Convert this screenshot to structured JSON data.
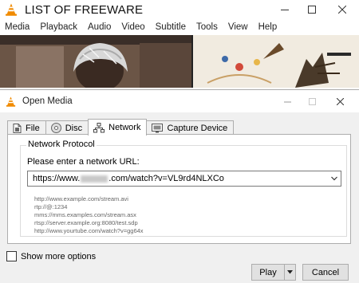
{
  "main_window": {
    "title": "LIST OF FREEWARE",
    "menu": [
      "Media",
      "Playback",
      "Audio",
      "Video",
      "Subtitle",
      "Tools",
      "View",
      "Help"
    ]
  },
  "dialog": {
    "title": "Open Media",
    "tabs": [
      {
        "label": "File",
        "icon": "file-icon"
      },
      {
        "label": "Disc",
        "icon": "disc-icon"
      },
      {
        "label": "Network",
        "icon": "network-icon",
        "active": true
      },
      {
        "label": "Capture Device",
        "icon": "capture-device-icon"
      }
    ],
    "group_title": "Network Protocol",
    "url_prompt": "Please enter a network URL:",
    "url_value_start": "https://www.",
    "url_value_end": ".com/watch?v=VL9rd4NLXCo",
    "examples": [
      "http://www.example.com/stream.avi",
      "rtp://@:1234",
      "mms://mms.examples.com/stream.asx",
      "rtsp://server.example.org:8080/test.sdp",
      "http://www.yourtube.com/watch?v=gg64x"
    ],
    "show_more_label": "Show more options",
    "show_more_checked": false,
    "play_label": "Play",
    "cancel_label": "Cancel"
  },
  "colors": {
    "vlc_orange": "#f08a00",
    "button_face": "#e1e1e1",
    "dialog_bg": "#f0f0f0"
  }
}
